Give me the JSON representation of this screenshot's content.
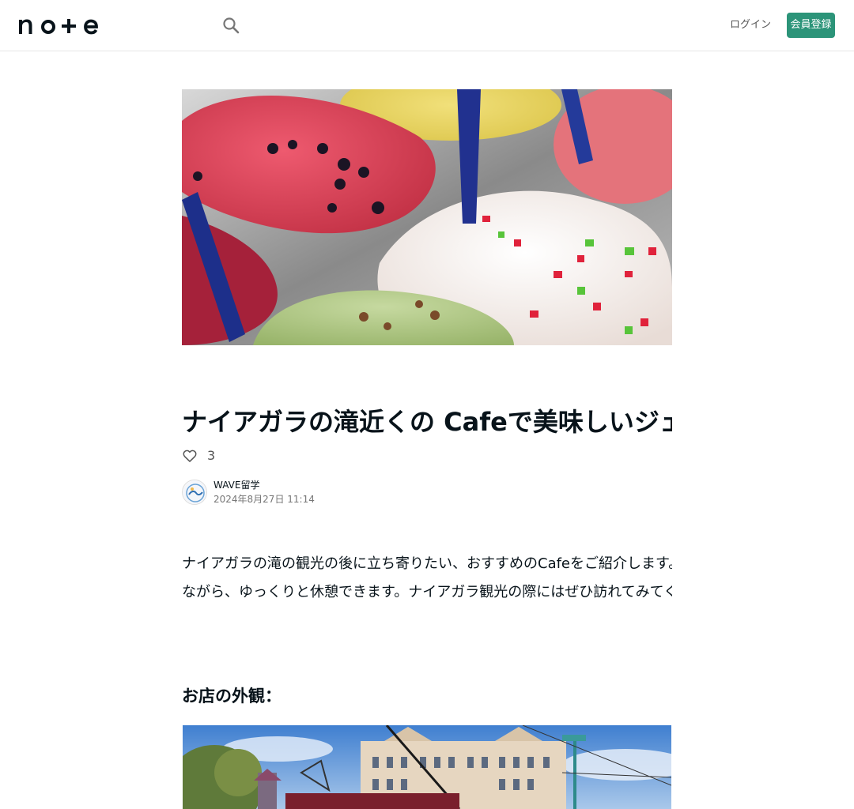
{
  "header": {
    "logo_text": "note",
    "login_label": "ログイン",
    "signup_label": "会員登録",
    "accent_color": "#2c9479"
  },
  "article": {
    "hero_image": "ice-cream-gelato-photo",
    "title": "ナイアガラの滝近くの Cafeで美味しいジェラート",
    "like_count": "3",
    "author_name": "WAVE留学",
    "post_date": "2024年8月27日 11:14",
    "paragraphs": [
      "ナイアガラの滝の観光の後に立ち寄りたい、おすすめのCafeをご紹介します。美味しいジェラートを食べ",
      "ながら、ゆっくりと休憩できます。ナイアガラ観光の際にはぜひ訪れてみてください。"
    ],
    "section_heading": "お店の外観：",
    "section_image": "cafe-exterior-photo"
  }
}
